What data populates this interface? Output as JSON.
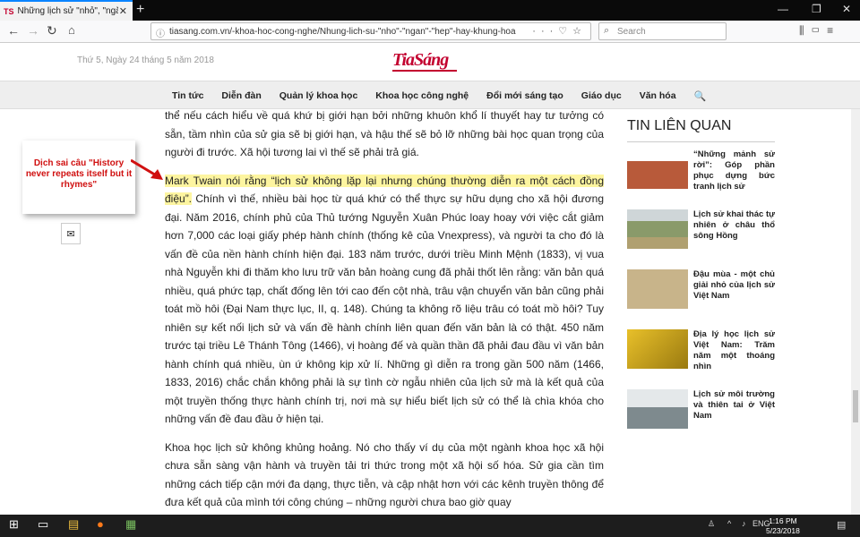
{
  "browser": {
    "tab_favicon": "TS",
    "tab_title": "Những lịch sử \"nhỏ\", \"ngắn\", \"hẹp\" ...",
    "url": "tiasang.com.vn/-khoa-hoc-cong-nghe/Nhung-lich-su-\"nho\"-\"ngan\"-\"hep\"-hay-khung-hoa",
    "search_placeholder": "Search",
    "win_min": "—",
    "win_restore": "❐",
    "win_close": "✕",
    "new_tab": "+",
    "tab_close": "✕"
  },
  "site": {
    "date": "Thứ 5, Ngày 24 tháng 5 năm 2018",
    "logo": "TiaSáng",
    "menu": [
      "Tin tức",
      "Diễn đàn",
      "Quản lý khoa học",
      "Khoa học công nghệ",
      "Đổi mới sáng tạo",
      "Giáo dục",
      "Văn hóa"
    ]
  },
  "callout": {
    "text": "Dịch sai câu \"History never repeats itself but it rhymes\""
  },
  "article": {
    "p1": "thể nếu cách hiểu về quá khứ bị giới hạn bởi những khuôn khổ lí thuyết hay tư tưởng có sẵn, tầm nhìn của sử gia sẽ bị giới hạn, và hậu thế sẽ bỏ lỡ những bài học quan trọng của người đi trước. Xã hội tương lai vì thế sẽ phải trả giá.",
    "p2_highlight": "Mark Twain nói rằng “lịch sử không lặp lại nhưng chúng thường diễn ra một cách đồng điệu”.",
    "p2_rest": " Chính vì thế, nhiều bài học từ quá khứ có thể thực sự hữu dụng cho xã hội đương đại. Năm 2016, chính phủ của Thủ tướng Nguyễn Xuân Phúc loay hoay với việc cắt giảm hơn 7,000 các loại giấy phép hành chính (thống kê của Vnexpress), và người ta cho đó là vấn đề của nền hành chính hiện đại. 183 năm trước, dưới triều Minh Mệnh (1833), vị vua nhà Nguyễn khi đi thăm kho lưu trữ văn bản hoàng cung đã phải thốt lên rằng: văn bản quá nhiều, quá phức tạp, chất đống lên tới cao đến cột nhà, trâu vận chuyển văn bản cũng phải toát mồ hôi (Đại Nam thực lục, II, q. 148). Chúng ta không rõ liệu trâu có toát mồ hôi? Tuy nhiên sự kết nối lịch sử và vấn đề hành chính liên quan đến văn bản là có thật. 450 năm trước tại triều Lê Thánh Tông (1466), vị hoàng đế và quần thần đã phải đau đầu vì văn bản hành chính quá nhiều, ùn ứ không kịp xử lí. Những gì diễn ra trong gần 500 năm (1466, 1833, 2016) chắc chắn không phải là sự tình cờ ngẫu nhiên của lịch sử mà là kết quả của một truyền thống thực hành chính trị, nơi mà sự hiểu biết lịch sử có thể là chìa khóa cho những vấn đề đau đầu ở hiện tại.",
    "p3": "Khoa học lịch sử không khủng hoảng. Nó cho thấy ví dụ của một ngành khoa học xã hội chưa sẵn sàng vận hành và truyền tải tri thức trong một xã hội số hóa. Sử gia cần tìm những cách tiếp cận mới đa dạng, thực tiễn, và cập nhật hơn với các kênh truyền thông để đưa kết quả của mình tới công chúng – những người chưa bao giờ quay"
  },
  "sidebar": {
    "heading": "TIN LIÊN QUAN",
    "items": [
      {
        "title": "“Những mảnh sử rời”: Góp phần phục dựng bức tranh lịch sử",
        "thumb_color": "#b85a3a"
      },
      {
        "title": "Lịch sử khai thác tự nhiên ở châu thổ sông Hồng",
        "thumb_color": "#8a9a6a"
      },
      {
        "title": "Đậu mùa - một chủ giải nhỏ của lịch sử Việt Nam",
        "thumb_color": "#c8b48a"
      },
      {
        "title": "Địa lý học lịch sử Việt Nam: Trăm năm một thoáng nhìn",
        "thumb_color": "#c9a21a"
      },
      {
        "title": "Lịch sử môi trường và thiên tai ở Việt Nam",
        "thumb_color": "#7e8a8e"
      }
    ]
  },
  "taskbar": {
    "lang": "ENG",
    "time": "1:16 PM",
    "date": "5/23/2018"
  },
  "icons": {
    "back": "back-arrow-icon",
    "forward": "forward-arrow-icon",
    "reload": "reload-icon",
    "home": "home-icon",
    "search": "search-icon",
    "email": "email-icon",
    "windows": "windows-start-icon",
    "firefox": "firefox-icon"
  }
}
